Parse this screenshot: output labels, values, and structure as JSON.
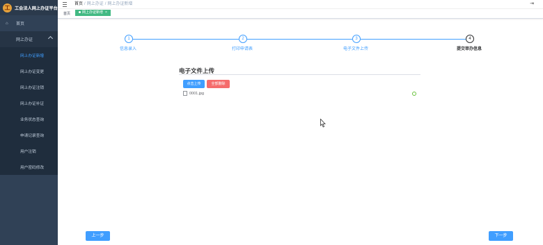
{
  "app": {
    "title": "工会法人网上办证平台"
  },
  "sidebar": {
    "home_label": "首页",
    "group_label": "网上办证",
    "items": [
      {
        "label": "网上办证新增",
        "active": true
      },
      {
        "label": "网上办证变更"
      },
      {
        "label": "网上办证注销"
      },
      {
        "label": "网上办证补证"
      },
      {
        "label": "业务状态查询"
      },
      {
        "label": "申请记录查询"
      },
      {
        "label": "用户注销"
      },
      {
        "label": "用户密码修改"
      }
    ]
  },
  "breadcrumb": {
    "items": [
      "首页",
      "网上办证",
      "网上办证新增"
    ]
  },
  "tags": {
    "home": "首页",
    "active": "网上办证新增"
  },
  "steps": [
    {
      "number": "1",
      "label": "信息录入"
    },
    {
      "number": "2",
      "label": "打印申请表"
    },
    {
      "number": "3",
      "label": "电子文件上传"
    },
    {
      "number": "4",
      "label": "提交审办信息"
    }
  ],
  "upload": {
    "title": "电子文件上传",
    "upload_button": "点击上传",
    "delete_all_button": "全部删除",
    "files": [
      {
        "name": "0001.jpg"
      }
    ]
  },
  "footer": {
    "prev": "上一步",
    "next": "下一步"
  },
  "colors": {
    "primary": "#409eff",
    "danger": "#f56c6c",
    "success": "#42b983",
    "sidebar_bg": "#304156"
  }
}
